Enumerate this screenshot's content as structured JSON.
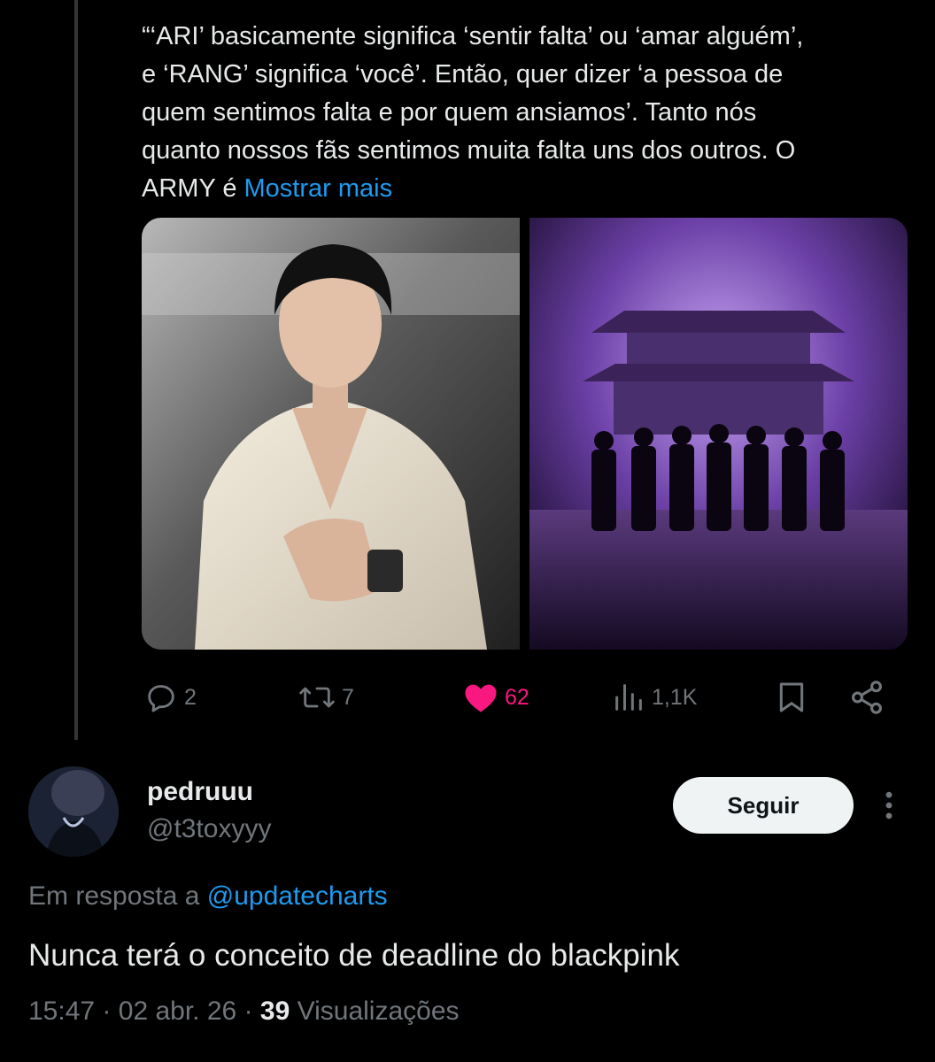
{
  "quoted_tweet": {
    "text_lines": [
      "“‘ARI’ basicamente significa ‘sentir falta’ ou ‘amar alguém’,",
      "e ‘RANG’ significa ‘você’. Então, quer dizer ‘a pessoa de",
      "quem sentimos falta e por quem ansiamos’. Tanto nós",
      "quanto nossos fãs sentimos muita falta uns dos outros. O"
    ],
    "last_line_text": "ARMY é",
    "show_more_label": "Mostrar mais",
    "actions": {
      "replies": "2",
      "retweets": "7",
      "likes": "62",
      "views": "1,1K"
    }
  },
  "reply_tweet": {
    "user": {
      "name": "pedruuu",
      "handle": "@t3toxyyy"
    },
    "follow_label": "Seguir",
    "reply_prefix": "Em resposta a",
    "reply_mention": "@updatecharts",
    "text": "Nunca terá o conceito de deadline do blackpink",
    "time": "15:47",
    "date": "02 abr. 26",
    "views_count": "39",
    "views_label": "Visualizações"
  },
  "colors": {
    "background": "#000000",
    "text_primary": "#e7e9ea",
    "text_secondary": "#71767b",
    "accent": "#1d9bf0",
    "like": "#f91880"
  },
  "icons": [
    "reply-icon",
    "retweet-icon",
    "heart-icon",
    "views-icon",
    "bookmark-icon",
    "share-icon",
    "more-icon"
  ]
}
